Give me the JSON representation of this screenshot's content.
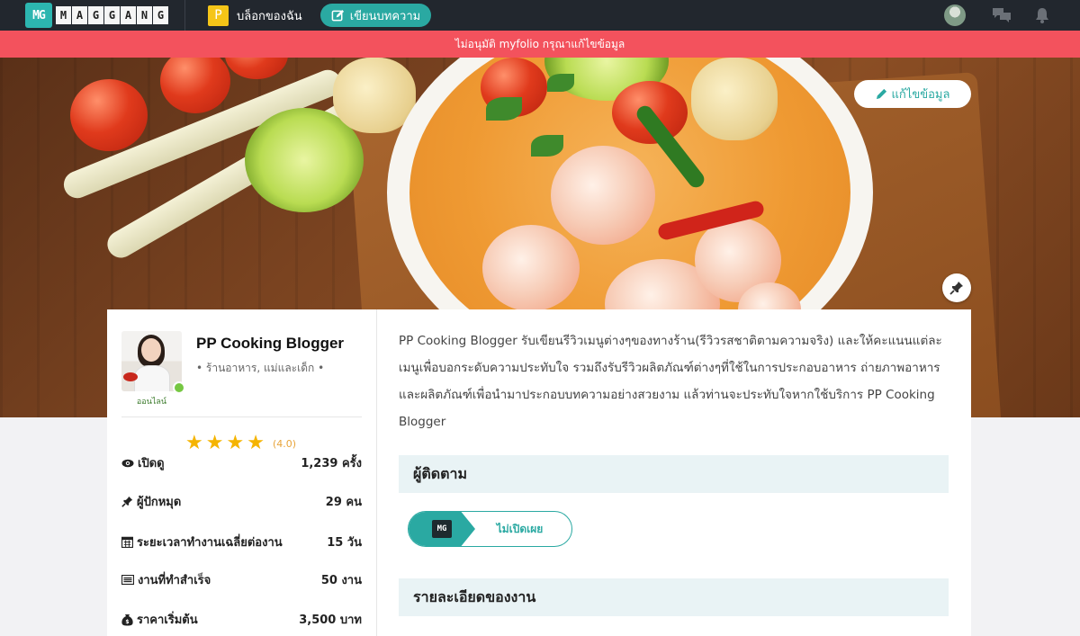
{
  "nav": {
    "logo_mark": "MG",
    "logo_letters": [
      "M",
      "A",
      "G",
      "G",
      "A",
      "N",
      "G"
    ],
    "blog_avatar": "P",
    "my_blog_label": "บล็อกของฉัน",
    "write_article_label": "เขียนบทความ"
  },
  "alert": {
    "message": "ไม่อนุมัติ myfolio กรุณาแก้ไขข้อมูล",
    "color": "#f3525d"
  },
  "cover": {
    "edit_label": "แก้ไขข้อมูล"
  },
  "profile": {
    "name": "PP Cooking Blogger",
    "tags": "•  ร้านอาหาร, แม่และเด็ก  •",
    "status": "ออนไลน์",
    "rating_stars": 4,
    "rating_text": "(4.0)"
  },
  "stats": [
    {
      "icon": "eye-icon",
      "label": "เปิดดู",
      "value": "1,239 ครั้ง"
    },
    {
      "icon": "pin-icon",
      "label": "ผู้ปักหมุด",
      "value": "29 คน"
    },
    {
      "icon": "calendar-icon",
      "label": "ระยะเวลาทำงานเฉลี่ยต่องาน",
      "value": "15 วัน"
    },
    {
      "icon": "list-icon",
      "label": "งานที่ทำสำเร็จ",
      "value": "50 งาน"
    },
    {
      "icon": "money-bag-icon",
      "label": "ราคาเริ่มต้น",
      "value": "3,500 บาท"
    }
  ],
  "description": "PP Cooking Blogger รับเขียนรีวิวเมนูต่างๆของทางร้าน(รีวิวรสชาติตามความจริง) และให้คะแนนแต่ละเมนูเพื่อบอกระดับความประทับใจ รวมถึงรับรีวิวผลิตภัณฑ์ต่างๆที่ใช้ในการประกอบอาหาร ถ่ายภาพอาหารและผลิตภัณฑ์เพื่อนำมาประกอบบทความอย่างสวยงาม แล้วท่านจะประทับใจหากใช้บริการ PP Cooking Blogger",
  "followers": {
    "title": "ผู้ติดตาม",
    "badge": "MG",
    "visibility": "ไม่เปิดเผย"
  },
  "work_details": {
    "title": "รายละเอียดของงาน"
  },
  "colors": {
    "accent": "#2aa9a2",
    "nav_bg": "#22272e",
    "star": "#f5b400"
  }
}
